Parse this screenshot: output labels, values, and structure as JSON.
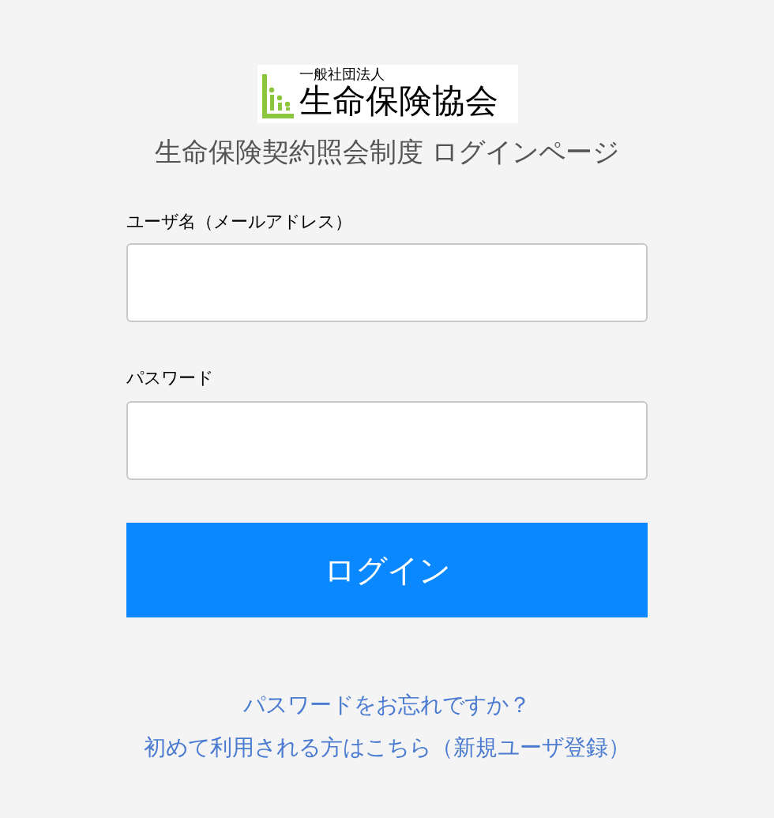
{
  "logo": {
    "subtitle": "一般社団法人",
    "name": "生命保険協会"
  },
  "page_title": "生命保険契約照会制度 ログインページ",
  "fields": [
    {
      "label": "ユーザ名（メールアドレス）"
    },
    {
      "label": "パスワード"
    }
  ],
  "login_button": "ログイン",
  "links": [
    "パスワードをお忘れですか？",
    "初めて利用される方はこちら（新規ユーザ登録）"
  ]
}
